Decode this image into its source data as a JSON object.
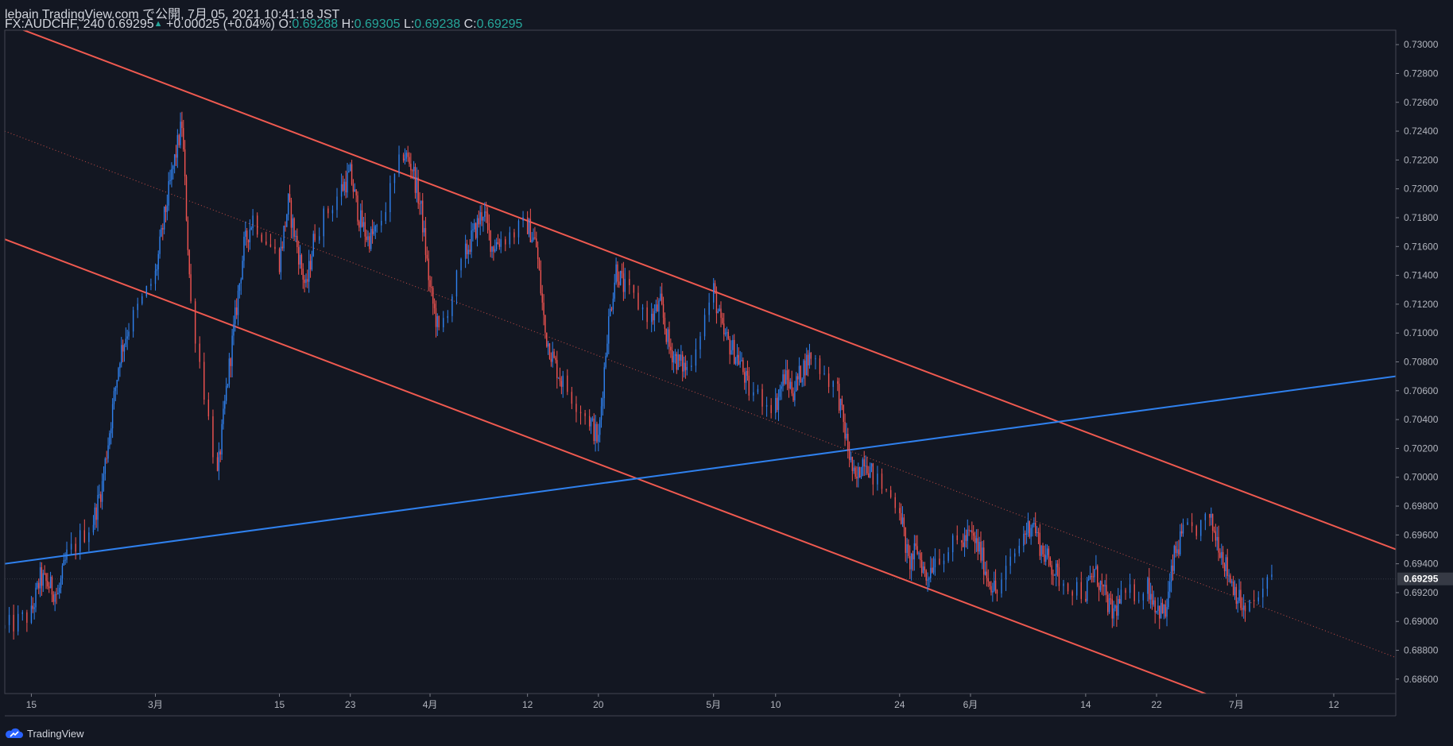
{
  "header": {
    "publisher_line": "lebain TradingView.com で公開, 7月 05, 2021 10:41:18 JST",
    "symbol": "FX:AUDCHF, 240",
    "last": "0.69295",
    "change": "+0.00025 (+0.04%)",
    "o_label": "O:",
    "o_value": "0.69288",
    "h_label": "H:",
    "h_value": "0.69305",
    "l_label": "L:",
    "l_value": "0.69238",
    "c_label": "C:",
    "c_value": "0.69295"
  },
  "footer": {
    "brand": "TradingView"
  },
  "colors": {
    "background": "#131722",
    "bull": "#2f80ed",
    "bear": "#ef5350",
    "channel": "#f05a50",
    "trend": "#2f80ed",
    "price_tag": "#363a45"
  },
  "chart_data": {
    "type": "candlestick",
    "price_axis": {
      "ylim": [
        0.685,
        0.731
      ],
      "ticks": [
        "0.73000",
        "0.72800",
        "0.72600",
        "0.72400",
        "0.72200",
        "0.72000",
        "0.71800",
        "0.71600",
        "0.71400",
        "0.71200",
        "0.71000",
        "0.70800",
        "0.70600",
        "0.70400",
        "0.70200",
        "0.70000",
        "0.69800",
        "0.69600",
        "0.69400",
        "0.69200",
        "0.69000",
        "0.68800",
        "0.68600"
      ],
      "current_price_label": "0.69295",
      "current_price": 0.69295
    },
    "time_axis": {
      "labels": [
        {
          "text": "15",
          "date": "2021-02-15"
        },
        {
          "text": "3月",
          "date": "2021-03-01"
        },
        {
          "text": "15",
          "date": "2021-03-15"
        },
        {
          "text": "23",
          "date": "2021-03-23"
        },
        {
          "text": "4月",
          "date": "2021-04-01"
        },
        {
          "text": "12",
          "date": "2021-04-12"
        },
        {
          "text": "20",
          "date": "2021-04-20"
        },
        {
          "text": "5月",
          "date": "2021-05-03"
        },
        {
          "text": "10",
          "date": "2021-05-10"
        },
        {
          "text": "24",
          "date": "2021-05-24"
        },
        {
          "text": "6月",
          "date": "2021-06-01"
        },
        {
          "text": "14",
          "date": "2021-06-14"
        },
        {
          "text": "22",
          "date": "2021-06-22"
        },
        {
          "text": "7月",
          "date": "2021-07-01"
        },
        {
          "text": "12",
          "date": "2021-07-12"
        }
      ]
    },
    "price_path": [
      [
        "2021-02-12",
        0.6895
      ],
      [
        "2021-02-15",
        0.6905
      ],
      [
        "2021-02-16",
        0.693
      ],
      [
        "2021-02-17",
        0.6925
      ],
      [
        "2021-02-18",
        0.6918
      ],
      [
        "2021-02-19",
        0.6945
      ],
      [
        "2021-02-22",
        0.697
      ],
      [
        "2021-02-23",
        0.6995
      ],
      [
        "2021-02-24",
        0.704
      ],
      [
        "2021-02-25",
        0.7085
      ],
      [
        "2021-02-26",
        0.7105
      ],
      [
        "2021-03-01",
        0.714
      ],
      [
        "2021-03-02",
        0.718
      ],
      [
        "2021-03-03",
        0.7215
      ],
      [
        "2021-03-04",
        0.7245
      ],
      [
        "2021-03-05",
        0.712
      ],
      [
        "2021-03-08",
        0.7
      ],
      [
        "2021-03-09",
        0.706
      ],
      [
        "2021-03-10",
        0.711
      ],
      [
        "2021-03-11",
        0.716
      ],
      [
        "2021-03-12",
        0.718
      ],
      [
        "2021-03-15",
        0.715
      ],
      [
        "2021-03-16",
        0.719
      ],
      [
        "2021-03-17",
        0.716
      ],
      [
        "2021-03-18",
        0.713
      ],
      [
        "2021-03-19",
        0.717
      ],
      [
        "2021-03-22",
        0.72
      ],
      [
        "2021-03-23",
        0.721
      ],
      [
        "2021-03-24",
        0.718
      ],
      [
        "2021-03-25",
        0.7165
      ],
      [
        "2021-03-26",
        0.717
      ],
      [
        "2021-03-29",
        0.7225
      ],
      [
        "2021-03-30",
        0.7215
      ],
      [
        "2021-03-31",
        0.7185
      ],
      [
        "2021-04-01",
        0.713
      ],
      [
        "2021-04-02",
        0.71
      ],
      [
        "2021-04-05",
        0.7155
      ],
      [
        "2021-04-06",
        0.717
      ],
      [
        "2021-04-07",
        0.7185
      ],
      [
        "2021-04-08",
        0.716
      ],
      [
        "2021-04-09",
        0.7165
      ],
      [
        "2021-04-12",
        0.7175
      ],
      [
        "2021-04-13",
        0.716
      ],
      [
        "2021-04-14",
        0.71
      ],
      [
        "2021-04-15",
        0.708
      ],
      [
        "2021-04-16",
        0.7065
      ],
      [
        "2021-04-19",
        0.704
      ],
      [
        "2021-04-20",
        0.7025
      ],
      [
        "2021-04-21",
        0.71
      ],
      [
        "2021-04-22",
        0.7145
      ],
      [
        "2021-04-23",
        0.713
      ],
      [
        "2021-04-26",
        0.711
      ],
      [
        "2021-04-27",
        0.712
      ],
      [
        "2021-04-28",
        0.709
      ],
      [
        "2021-04-29",
        0.708
      ],
      [
        "2021-04-30",
        0.7075
      ],
      [
        "2021-05-03",
        0.713
      ],
      [
        "2021-05-04",
        0.71
      ],
      [
        "2021-05-05",
        0.709
      ],
      [
        "2021-05-06",
        0.708
      ],
      [
        "2021-05-07",
        0.706
      ],
      [
        "2021-05-10",
        0.705
      ],
      [
        "2021-05-11",
        0.707
      ],
      [
        "2021-05-12",
        0.706
      ],
      [
        "2021-05-13",
        0.7075
      ],
      [
        "2021-05-14",
        0.7085
      ],
      [
        "2021-05-17",
        0.706
      ],
      [
        "2021-05-18",
        0.7025
      ],
      [
        "2021-05-19",
        0.6995
      ],
      [
        "2021-05-20",
        0.7015
      ],
      [
        "2021-05-21",
        0.7
      ],
      [
        "2021-05-24",
        0.698
      ],
      [
        "2021-05-25",
        0.694
      ],
      [
        "2021-05-26",
        0.695
      ],
      [
        "2021-05-27",
        0.693
      ],
      [
        "2021-05-28",
        0.6945
      ],
      [
        "2021-05-31",
        0.6955
      ],
      [
        "2021-06-01",
        0.696
      ],
      [
        "2021-06-02",
        0.695
      ],
      [
        "2021-06-03",
        0.693
      ],
      [
        "2021-06-04",
        0.692
      ],
      [
        "2021-06-07",
        0.696
      ],
      [
        "2021-06-08",
        0.697
      ],
      [
        "2021-06-09",
        0.695
      ],
      [
        "2021-06-10",
        0.694
      ],
      [
        "2021-06-11",
        0.693
      ],
      [
        "2021-06-14",
        0.692
      ],
      [
        "2021-06-15",
        0.6935
      ],
      [
        "2021-06-16",
        0.692
      ],
      [
        "2021-06-17",
        0.6905
      ],
      [
        "2021-06-18",
        0.6915
      ],
      [
        "2021-06-21",
        0.6925
      ],
      [
        "2021-06-22",
        0.691
      ],
      [
        "2021-06-23",
        0.6905
      ],
      [
        "2021-06-24",
        0.6945
      ],
      [
        "2021-06-25",
        0.696
      ],
      [
        "2021-06-28",
        0.697
      ],
      [
        "2021-06-29",
        0.6955
      ],
      [
        "2021-06-30",
        0.6935
      ],
      [
        "2021-07-01",
        0.692
      ],
      [
        "2021-07-02",
        0.6905
      ],
      [
        "2021-07-05",
        0.693
      ]
    ],
    "drawings": [
      {
        "name": "channel-upper",
        "style": "solid",
        "from": [
          "2021-02-12",
          0.7315
        ],
        "to": [
          "2021-07-19",
          0.695
        ]
      },
      {
        "name": "channel-middle",
        "style": "dotted",
        "from": [
          "2021-02-12",
          0.724
        ],
        "to": [
          "2021-07-19",
          0.6875
        ]
      },
      {
        "name": "channel-lower",
        "style": "solid",
        "from": [
          "2021-02-12",
          0.7165
        ],
        "to": [
          "2021-07-19",
          0.68
        ]
      },
      {
        "name": "trendline",
        "style": "solid",
        "from": [
          "2021-02-12",
          0.694
        ],
        "to": [
          "2021-07-19",
          0.707
        ]
      }
    ]
  }
}
